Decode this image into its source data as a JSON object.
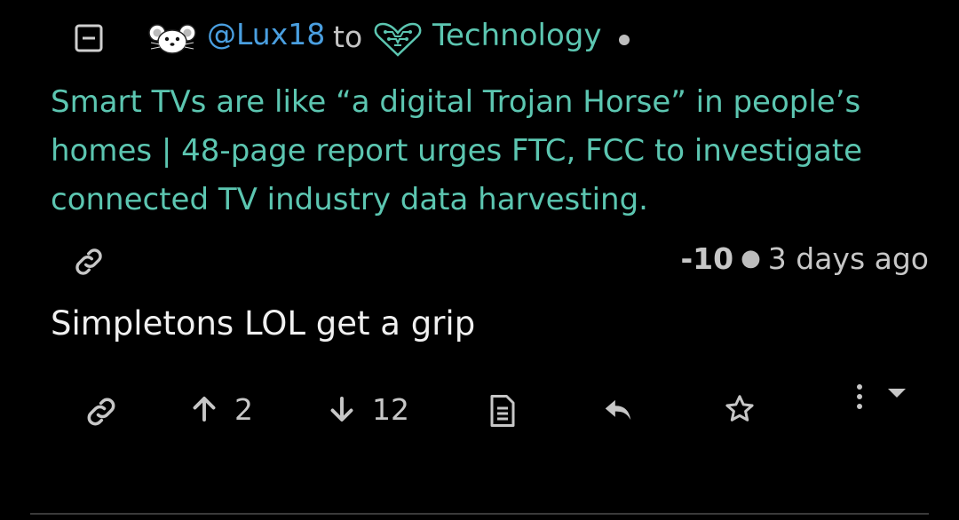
{
  "header": {
    "username": "@Lux18",
    "to_word": "to",
    "community": "Technology"
  },
  "post": {
    "title": "Smart TVs are like “a digital Trojan Horse” in people’s homes | 48-page report urges FTC, FCC to investigate connected TV industry data harvesting."
  },
  "meta": {
    "score": "-10",
    "time": "3 days ago"
  },
  "comment": {
    "body": "Simpletons LOL get a grip"
  },
  "actions": {
    "upvotes": "2",
    "downvotes": "12"
  },
  "colors": {
    "background": "#000000",
    "username": "#4a9fe0",
    "community": "#5cc6b1",
    "text": "#f0f0f0",
    "muted": "#c7c7c7"
  },
  "icons": [
    "collapse-icon",
    "mouse-avatar-icon",
    "heart-circuit-icon",
    "link-icon",
    "arrow-up-icon",
    "arrow-down-icon",
    "document-icon",
    "reply-icon",
    "star-icon",
    "vertical-dots-icon",
    "caret-down-icon"
  ]
}
